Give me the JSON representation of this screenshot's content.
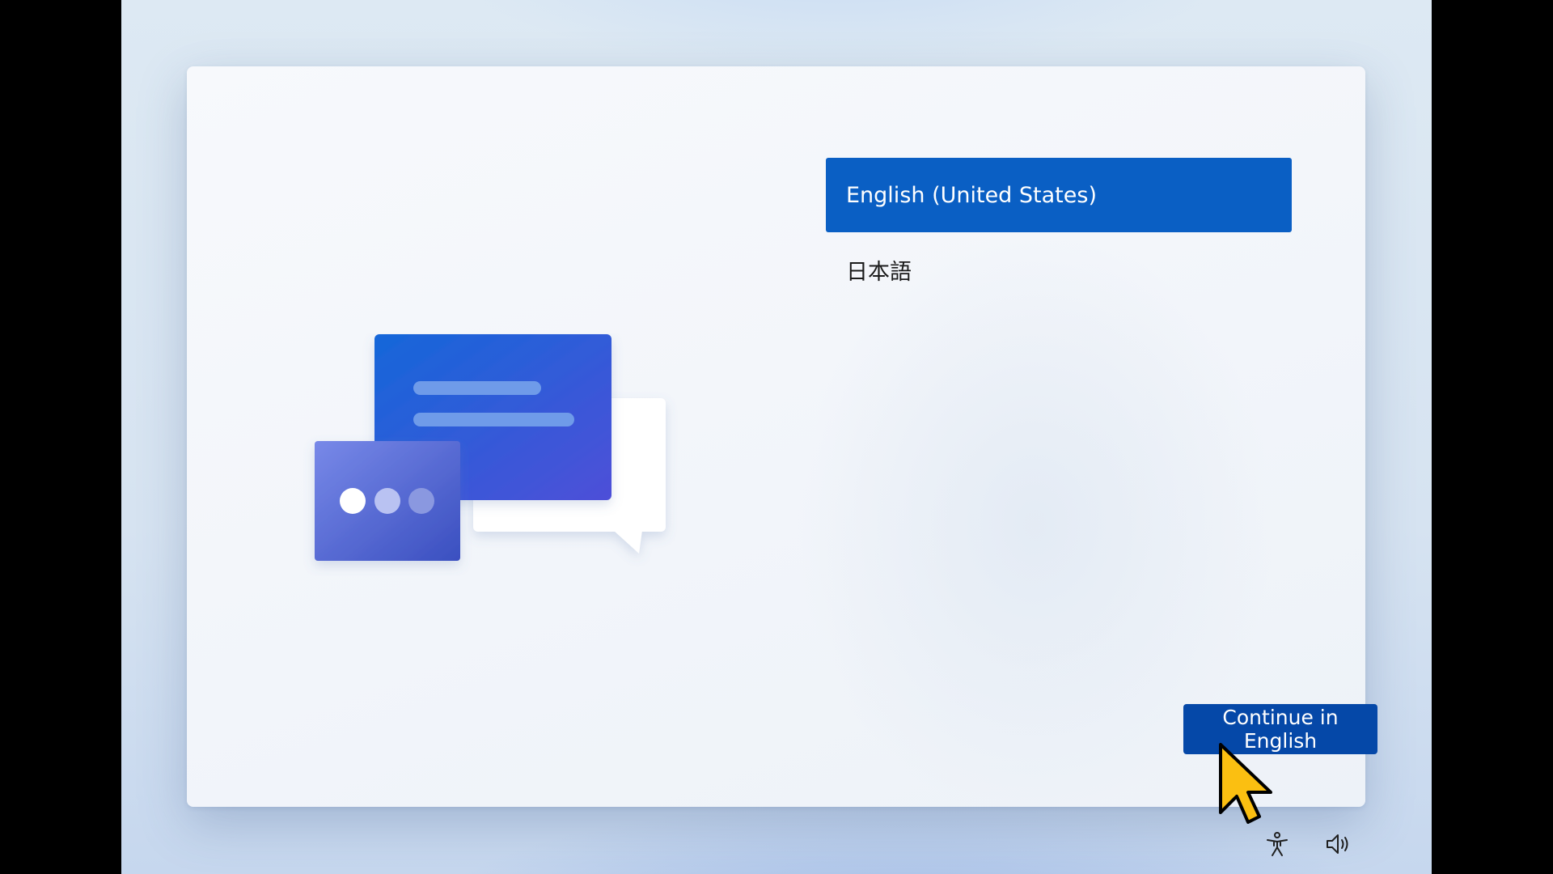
{
  "languages": {
    "items": [
      {
        "label": "English (United States)",
        "selected": true
      },
      {
        "label": "日本語",
        "selected": false
      }
    ]
  },
  "actions": {
    "continue_label": "Continue in English"
  },
  "system_tray": {
    "icons": [
      "accessibility-icon",
      "volume-icon"
    ]
  },
  "colors": {
    "accent": "#0a5fc4",
    "button": "#0548a8",
    "cursor_fill": "#fbbf11"
  }
}
